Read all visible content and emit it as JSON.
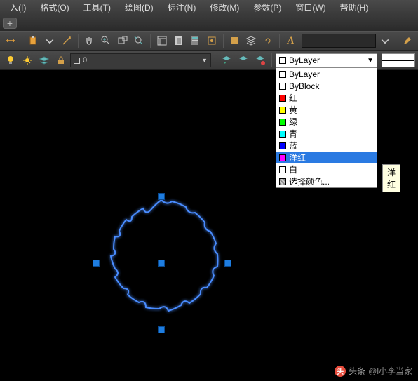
{
  "menu": {
    "items": [
      "入(I)",
      "格式(O)",
      "工具(T)",
      "绘图(D)",
      "标注(N)",
      "修改(M)",
      "参数(P)",
      "窗口(W)",
      "帮助(H)"
    ]
  },
  "tab": {
    "add": "+"
  },
  "layerCombo": {
    "value": "0"
  },
  "colorCombo": {
    "selected": "ByLayer",
    "options": [
      {
        "color": "#ffffff",
        "label": "ByLayer"
      },
      {
        "color": "#ffffff",
        "label": "ByBlock"
      },
      {
        "color": "#ff0000",
        "label": "红"
      },
      {
        "color": "#ffff00",
        "label": "黄"
      },
      {
        "color": "#00ff00",
        "label": "绿"
      },
      {
        "color": "#00ffff",
        "label": "青"
      },
      {
        "color": "#0000ff",
        "label": "蓝"
      },
      {
        "color": "#ff00ff",
        "label": "洋红",
        "highlight": true
      },
      {
        "color": "#ffffff",
        "label": "白"
      },
      {
        "color": "#999999",
        "label": "选择颜色..."
      }
    ]
  },
  "tooltip": "洋红",
  "credit": {
    "prefix": "头条",
    "user": "@l小李当家"
  },
  "icons": {
    "chevdown": "▼"
  }
}
